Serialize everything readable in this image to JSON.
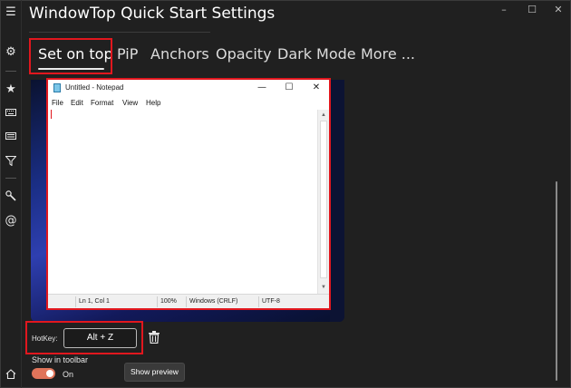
{
  "window": {
    "title": "WindowTop Quick Start Settings",
    "controls": {
      "minimize": "–",
      "maximize": "☐",
      "close": "✕"
    }
  },
  "rail": {
    "icons": [
      "hamburger-icon",
      "gear-icon",
      "star-icon",
      "keyboard-icon",
      "keyboard-alt-icon",
      "filter-icon",
      "wrench-icon",
      "at-icon",
      "home-icon"
    ],
    "glyphs": {
      "hamburger": "☰",
      "gear": "⚙",
      "star": "★",
      "filter": "⏷",
      "wrench": "🔧",
      "at": "@",
      "home": "⌂"
    }
  },
  "tabs": [
    {
      "label": "Set on top",
      "active": true
    },
    {
      "label": "PiP",
      "active": false
    },
    {
      "label": "Anchors",
      "active": false
    },
    {
      "label": "Opacity",
      "active": false
    },
    {
      "label": "Dark Mode",
      "active": false
    },
    {
      "label": "More ...",
      "active": false
    }
  ],
  "notepad": {
    "title": "Untitled - Notepad",
    "controls": {
      "minimize": "—",
      "maximize": "☐",
      "close": "✕"
    },
    "menu": [
      "File",
      "Edit",
      "Format",
      "View",
      "Help"
    ],
    "status": {
      "position": "Ln 1, Col 1",
      "zoom": "100%",
      "line_endings": "Windows (CRLF)",
      "encoding": "UTF-8"
    }
  },
  "hotkey": {
    "label": "HotKey:",
    "value": "Alt + Z"
  },
  "toolbar": {
    "label": "Show in toolbar",
    "toggle_text": "On",
    "toggle_on": true
  },
  "buttons": {
    "show_preview": "Show preview"
  },
  "colors": {
    "highlight": "#e1171e",
    "toggle_on": "#e0745a",
    "background": "#202020"
  }
}
